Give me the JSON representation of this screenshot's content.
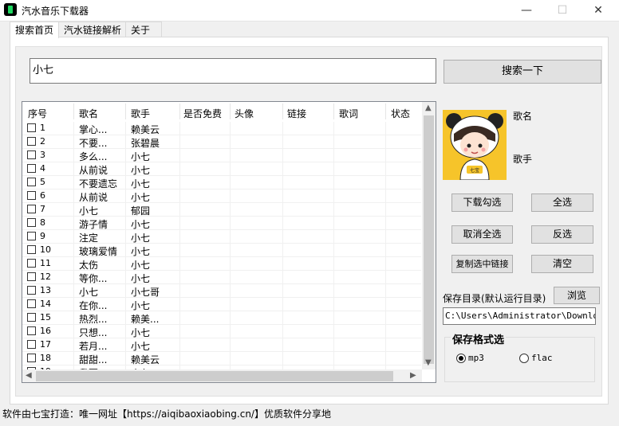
{
  "window": {
    "title": "汽水音乐下载器",
    "minimize": "—",
    "maximize": "☐",
    "close": "✕"
  },
  "tabs": [
    {
      "label": "搜索首页"
    },
    {
      "label": "汽水链接解析"
    },
    {
      "label": "关于"
    }
  ],
  "search": {
    "value": "小七",
    "button": "搜索一下"
  },
  "table": {
    "columns": [
      "序号",
      "歌名",
      "歌手",
      "是否免费",
      "头像",
      "链接",
      "歌词",
      "状态"
    ],
    "rows": [
      {
        "no": "1",
        "song": "掌心...",
        "artist": "赖美云"
      },
      {
        "no": "2",
        "song": "不要...",
        "artist": "张碧晨"
      },
      {
        "no": "3",
        "song": "多么...",
        "artist": "小七"
      },
      {
        "no": "4",
        "song": "从前说",
        "artist": "小七"
      },
      {
        "no": "5",
        "song": "不要遗忘",
        "artist": "小七"
      },
      {
        "no": "6",
        "song": "从前说",
        "artist": "小七"
      },
      {
        "no": "7",
        "song": "小七",
        "artist": "郁园"
      },
      {
        "no": "8",
        "song": "游子情",
        "artist": "小七"
      },
      {
        "no": "9",
        "song": "注定",
        "artist": "小七"
      },
      {
        "no": "10",
        "song": "玻璃爱情",
        "artist": "小七"
      },
      {
        "no": "11",
        "song": "太伤",
        "artist": "小七"
      },
      {
        "no": "12",
        "song": "等你...",
        "artist": "小七"
      },
      {
        "no": "13",
        "song": "小七",
        "artist": "小七哥"
      },
      {
        "no": "14",
        "song": "在你...",
        "artist": "小七"
      },
      {
        "no": "15",
        "song": "热烈...",
        "artist": "赖美..."
      },
      {
        "no": "16",
        "song": "只想...",
        "artist": "小七"
      },
      {
        "no": "17",
        "song": "若月...",
        "artist": "小七"
      },
      {
        "no": "18",
        "song": "甜甜...",
        "artist": "赖美云"
      },
      {
        "no": "19",
        "song": "我要...",
        "artist": "小七"
      }
    ]
  },
  "detail": {
    "song_label": "歌名",
    "artist_label": "歌手",
    "avatar_text": "七宝"
  },
  "actions": {
    "download_checked": "下载勾选",
    "select_all": "全选",
    "deselect_all": "取消全选",
    "invert": "反选",
    "copy_links": "复制选中链接",
    "clear": "清空"
  },
  "save": {
    "label": "保存目录(默认运行目录)",
    "browse": "浏览",
    "path": "C:\\Users\\Administrator\\Downloads"
  },
  "format": {
    "title": "保存格式选",
    "options": [
      "mp3",
      "flac"
    ],
    "selected": "mp3"
  },
  "footer": "软件由七宝打造：唯一网址【https://aiqibaoxiaobing.cn/】优质软件分享地",
  "colors": {
    "list_border": "#828790",
    "button_bg": "#e1e1e1",
    "avatar_bg": "#f6c42a"
  }
}
